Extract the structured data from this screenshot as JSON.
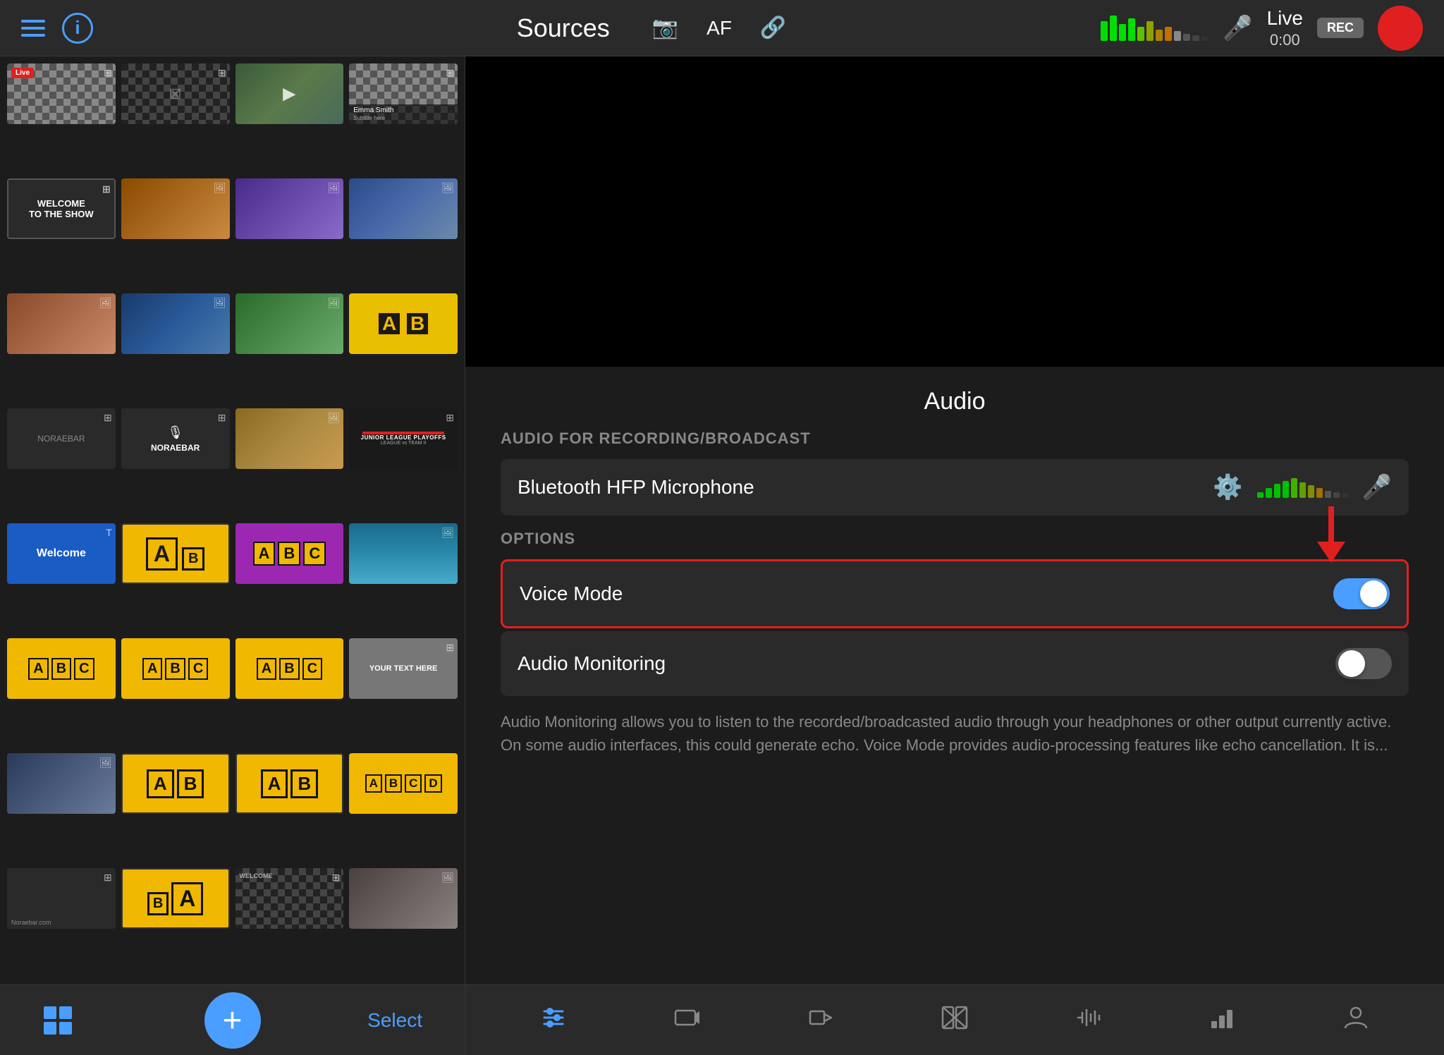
{
  "header": {
    "title": "Sources",
    "af_label": "AF",
    "live_label": "Live",
    "live_timer": "0:00",
    "rec_badge": "REC"
  },
  "audio_panel": {
    "title": "Audio",
    "recording_section_label": "AUDIO FOR RECORDING/BROADCAST",
    "device_name": "Bluetooth HFP Microphone",
    "options_label": "OPTIONS",
    "voice_mode_label": "Voice Mode",
    "audio_monitoring_label": "Audio Monitoring",
    "audio_info_text": "Audio Monitoring allows you to listen to the recorded/broadcasted audio through your headphones or other output currently active. On some audio interfaces, this could generate echo.\nVoice Mode provides audio-processing features like echo cancellation. It is..."
  },
  "bottom_bar": {
    "select_label": "Select",
    "add_label": "+"
  },
  "thumbnails": [
    {
      "id": 1,
      "type": "camera",
      "has_badge": true,
      "badge_text": "LIVE"
    },
    {
      "id": 2,
      "type": "dark_checkered",
      "has_overlay": true
    },
    {
      "id": 3,
      "type": "crowd",
      "has_play": true
    },
    {
      "id": 4,
      "type": "emma_smith",
      "has_layer": true
    },
    {
      "id": 5,
      "type": "welcome",
      "text": "WELCOME\nTO THE SHOW"
    },
    {
      "id": 6,
      "type": "concert"
    },
    {
      "id": 7,
      "type": "people"
    },
    {
      "id": 8,
      "type": "city1"
    },
    {
      "id": 9,
      "type": "building"
    },
    {
      "id": 10,
      "type": "city2"
    },
    {
      "id": 11,
      "type": "field"
    },
    {
      "id": 12,
      "type": "ab_letters"
    },
    {
      "id": 13,
      "type": "noraebar1"
    },
    {
      "id": 14,
      "type": "noraebar2"
    },
    {
      "id": 15,
      "type": "food"
    },
    {
      "id": 16,
      "type": "junior_league"
    },
    {
      "id": 17,
      "type": "welcome_blue",
      "text": "Welcome"
    },
    {
      "id": 18,
      "type": "ab2_letters"
    },
    {
      "id": 19,
      "type": "abc_purple"
    },
    {
      "id": 20,
      "type": "water"
    },
    {
      "id": 21,
      "type": "abc_yellow"
    },
    {
      "id": 22,
      "type": "abc2"
    },
    {
      "id": 23,
      "type": "abc3"
    },
    {
      "id": 24,
      "type": "your_text_here",
      "text": "YOUR TEXT HERE"
    },
    {
      "id": 25,
      "type": "animal"
    },
    {
      "id": 26,
      "type": "ab_yellow2"
    },
    {
      "id": 27,
      "type": "ab_yellow3"
    },
    {
      "id": 28,
      "type": "abcd"
    },
    {
      "id": 29,
      "type": "noraebar3"
    },
    {
      "id": 30,
      "type": "ba_large"
    },
    {
      "id": 31,
      "type": "welcome_small"
    },
    {
      "id": 32,
      "type": "family"
    }
  ],
  "right_bottom_tabs": [
    {
      "id": "mixer",
      "label": "Mixer",
      "active": true
    },
    {
      "id": "camera",
      "label": "Camera"
    },
    {
      "id": "goto",
      "label": "Go To"
    },
    {
      "id": "transitions",
      "label": "Transitions"
    },
    {
      "id": "audio-levels",
      "label": "Audio Levels"
    },
    {
      "id": "stats",
      "label": "Stats"
    },
    {
      "id": "person",
      "label": "Person"
    }
  ]
}
